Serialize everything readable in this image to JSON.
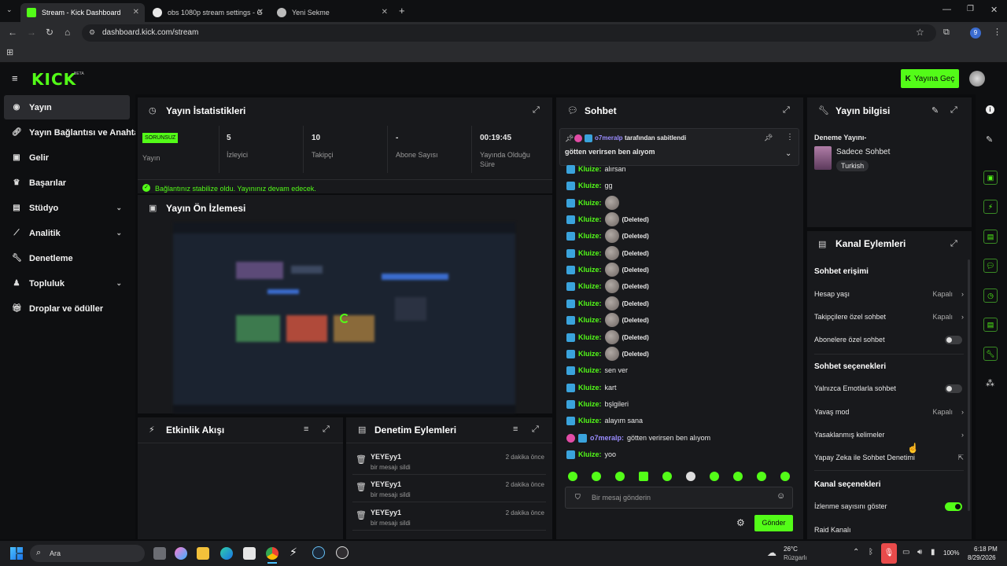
{
  "browser": {
    "tabs": [
      {
        "title": "Stream - Kick Dashboard"
      },
      {
        "title": "obs 1080p stream settings - G"
      },
      {
        "title": "Yeni Sekme"
      }
    ],
    "url": "dashboard.kick.com/stream",
    "profile_badge": "9"
  },
  "header": {
    "logo": "KICK",
    "logo_sup": "BETA",
    "go_live_label": "Yayına Geç"
  },
  "sidebar": {
    "items": [
      {
        "label": "Yayın"
      },
      {
        "label": "Yayın Bağlantısı ve Anahtarı"
      },
      {
        "label": "Gelir"
      },
      {
        "label": "Başarılar"
      },
      {
        "label": "Stüdyo"
      },
      {
        "label": "Analitik"
      },
      {
        "label": "Denetleme"
      },
      {
        "label": "Topluluk"
      },
      {
        "label": "Droplar ve ödüller"
      }
    ]
  },
  "stats": {
    "title": "Yayın İstatistikleri",
    "status_badge": "SORUNSUZ",
    "status_label": "Yayın",
    "viewers_value": "5",
    "viewers_label": "İzleyici",
    "followers_value": "10",
    "followers_label": "Takipçi",
    "subs_value": "-",
    "subs_label": "Abone Sayısı",
    "uptime_value": "00:19:45",
    "uptime_label": "Yayında Olduğu Süre",
    "notice": "Bağlantınız stabilize oldu. Yayınınız devam edecek."
  },
  "preview": {
    "title": "Yayın Ön İzlemesi"
  },
  "activity": {
    "title": "Etkinlik Akışı"
  },
  "moderation": {
    "title": "Denetim Eylemleri",
    "items": [
      {
        "user": "YEYEyy1",
        "action": "bir mesajı sildi",
        "time": "2 dakika önce"
      },
      {
        "user": "YEYEyy1",
        "action": "bir mesajı sildi",
        "time": "2 dakika önce"
      },
      {
        "user": "YEYEyy1",
        "action": "bir mesajı sildi",
        "time": "2 dakika önce"
      }
    ]
  },
  "chat": {
    "title": "Sohbet",
    "pinned_by": "o7meralp",
    "pinned_by_suffix": "tarafından sabitlendi",
    "pinned_text": "götten verirsen ben alıyom",
    "messages": [
      {
        "user": "Kluize:",
        "text": "alırsan"
      },
      {
        "user": "Kluize:",
        "text": "gg"
      },
      {
        "user": "Kluize:",
        "text": ""
      },
      {
        "user": "Kluize:",
        "text": "(Deleted)"
      },
      {
        "user": "Kluize:",
        "text": "(Deleted)"
      },
      {
        "user": "Kluize:",
        "text": "(Deleted)"
      },
      {
        "user": "Kluize:",
        "text": "(Deleted)"
      },
      {
        "user": "Kluize:",
        "text": "(Deleted)"
      },
      {
        "user": "Kluize:",
        "text": "(Deleted)"
      },
      {
        "user": "Kluize:",
        "text": "(Deleted)"
      },
      {
        "user": "Kluize:",
        "text": "(Deleted)"
      },
      {
        "user": "Kluize:",
        "text": "(Deleted)"
      },
      {
        "user": "Kluize:",
        "text": "sen ver"
      },
      {
        "user": "Kluize:",
        "text": "kart"
      },
      {
        "user": "Kluize:",
        "text": "bşlgileri"
      },
      {
        "user": "Kluize:",
        "text": "alayım sana"
      },
      {
        "user": "o7meralp:",
        "text": "götten verirsen ben alıyom"
      },
      {
        "user": "Kluize:",
        "text": "yoo"
      }
    ],
    "input_placeholder": "Bir mesaj gönderin",
    "send_label": "Gönder"
  },
  "stream_info": {
    "title": "Yayın bilgisi",
    "stream_title": "Deneme Yayını-",
    "category": "Sadece Sohbet",
    "language": "Turkish"
  },
  "channel_actions": {
    "title": "Kanal Eylemleri",
    "chat_access": "Sohbet erişimi",
    "account_age": "Hesap yaşı",
    "account_age_val": "Kapalı",
    "followers_only": "Takipçilere özel sohbet",
    "followers_only_val": "Kapalı",
    "subs_only": "Abonelere özel sohbet",
    "chat_options": "Sohbet seçenekleri",
    "emote_only": "Yalnızca Emotlarla sohbet",
    "slow_mode": "Yavaş mod",
    "slow_mode_val": "Kapalı",
    "banned_words": "Yasaklanmış kelimeler",
    "ai_moderation": "Yapay Zeka ile Sohbet Denetimi",
    "channel_options": "Kanal seçenekleri",
    "show_views": "İzlenme sayısını göster",
    "raid": "Raid Kanalı"
  },
  "taskbar": {
    "search": "Ara",
    "weather_temp": "26°C",
    "weather_desc": "Rüzgarlı",
    "battery": "100%",
    "time": "6:18 PM",
    "date": "8/29/2026"
  },
  "colors": {
    "accent": "#53fc18",
    "panel": "#18191c",
    "bg": "#0b0c0e"
  }
}
